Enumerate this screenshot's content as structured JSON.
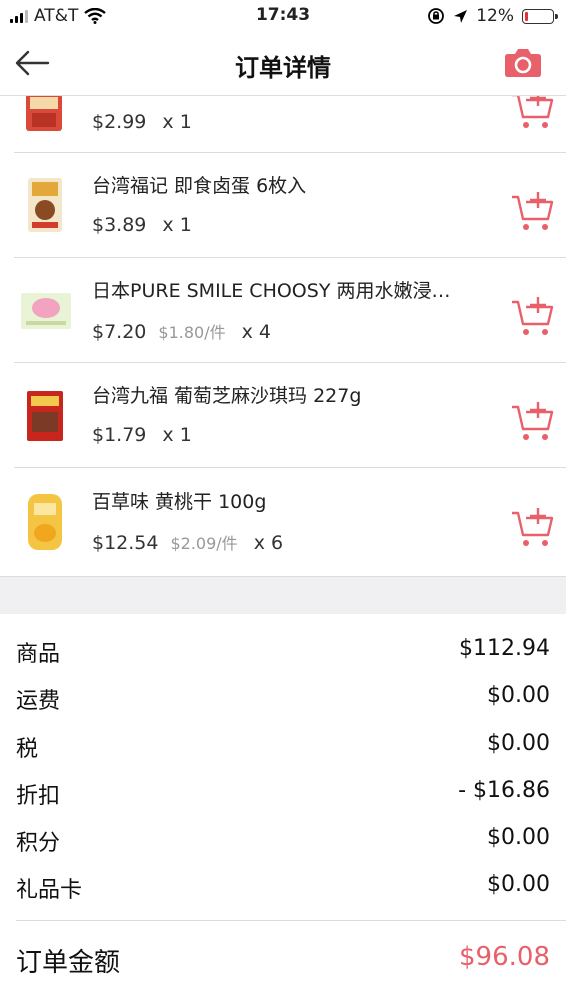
{
  "status_bar": {
    "carrier": "AT&T",
    "time": "17:43",
    "battery": "12%",
    "battery_level": 0.12,
    "icons": [
      "signal-icon",
      "wifi-icon",
      "orientation-lock-icon",
      "location-icon",
      "battery-icon"
    ]
  },
  "nav": {
    "title": "订单详情",
    "back_icon": "back-arrow-icon",
    "camera_icon": "camera-icon"
  },
  "items": [
    {
      "name": "",
      "price": "$2.99",
      "unit_price": "",
      "qty": "x 1"
    },
    {
      "name": "台湾福记 即食卤蛋 6枚入",
      "price": "$3.89",
      "unit_price": "",
      "qty": "x 1"
    },
    {
      "name": "日本PURE SMILE CHOOSY 两用水嫩浸…",
      "price": "$7.20",
      "unit_price": "$1.80/件",
      "qty": "x 4"
    },
    {
      "name": "台湾九福 葡萄芝麻沙琪玛 227g",
      "price": "$1.79",
      "unit_price": "",
      "qty": "x 1"
    },
    {
      "name": "百草味 黄桃干 100g",
      "price": "$12.54",
      "unit_price": "$2.09/件",
      "qty": "x 6"
    }
  ],
  "summary": {
    "rows": [
      {
        "label": "商品",
        "value": "$112.94"
      },
      {
        "label": "运费",
        "value": "$0.00"
      },
      {
        "label": "税",
        "value": "$0.00"
      },
      {
        "label": "折扣",
        "value": "- $16.86"
      },
      {
        "label": "积分",
        "value": "$0.00"
      },
      {
        "label": "礼品卡",
        "value": "$0.00"
      }
    ],
    "total_label": "订单金额",
    "total_value": "$96.08"
  },
  "colors": {
    "accent": "#e8606a",
    "battery_low": "#e33333",
    "band": "#f0f0f2"
  }
}
